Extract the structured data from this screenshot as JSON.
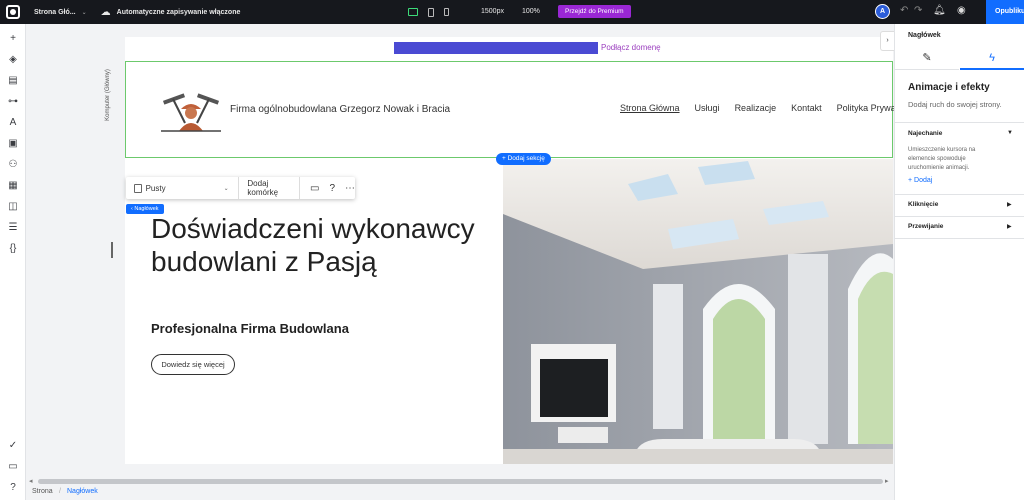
{
  "topbar": {
    "site_name": "Strona Głó...",
    "autosave": "Automatyczne zapisywanie włączone",
    "breakpoint": "1500px",
    "zoom": "100%",
    "premium": "Przejdź do Premium",
    "avatar": "A",
    "publish": "Opublikuj"
  },
  "canvas": {
    "domain_link": "Podłącz domenę",
    "device_label": "Komputer (Główny)",
    "company_name": "Firma ogólnobudowlana Grzegorz Nowak i Bracia",
    "nav": [
      "Strona Główna",
      "Usługi",
      "Realizacje",
      "Kontakt",
      "Polityka Prywat"
    ],
    "add_section": "+ Dodaj sekcję",
    "float_toolbar": {
      "pusty": "Pusty",
      "add_cell": "Dodaj komórkę"
    },
    "selection_tag": "‹ Nagłówek",
    "hero_title": "Doświadczeni wykonawcy budowlani z Pasją",
    "hero_subtitle": "Profesjonalna Firma Budowlana",
    "hero_button": "Dowiedz się więcej"
  },
  "breadcrumb": {
    "root": "Strona",
    "sep": "/",
    "current": "Nagłówek"
  },
  "panel": {
    "title": "Nagłówek",
    "heading": "Animacje i efekty",
    "description": "Dodaj ruch do swojej strony.",
    "hover_section": "Najechanie",
    "hover_desc": "Umieszczenie kursora na elemencie spowoduje uruchomienie animacji.",
    "add": "+ Dodaj",
    "click_section": "Kliknięcie",
    "scroll_section": "Przewijanie"
  },
  "colors": {
    "accent": "#116dff",
    "premium": "#9a27d5",
    "selection": "#6cc96c"
  }
}
